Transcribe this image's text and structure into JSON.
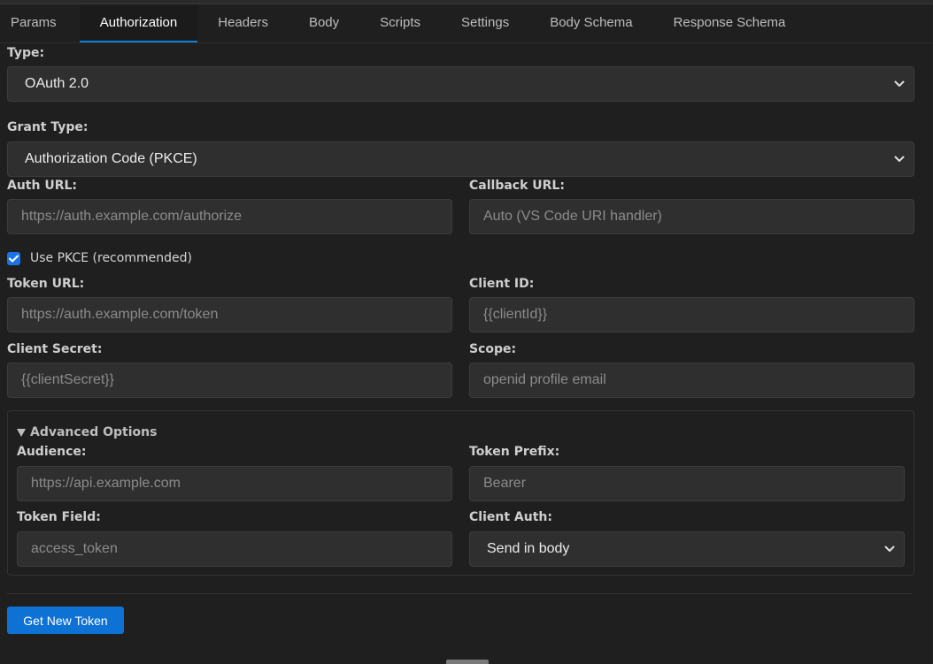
{
  "tabs": [
    {
      "label": "Params"
    },
    {
      "label": "Authorization"
    },
    {
      "label": "Headers"
    },
    {
      "label": "Body"
    },
    {
      "label": "Scripts"
    },
    {
      "label": "Settings"
    },
    {
      "label": "Body Schema"
    },
    {
      "label": "Response Schema"
    }
  ],
  "active_tab": "Authorization",
  "auth": {
    "type_label": "Type:",
    "type_value": "OAuth 2.0",
    "grant_label": "Grant Type:",
    "grant_value": "Authorization Code (PKCE)",
    "auth_url_label": "Auth URL:",
    "auth_url_placeholder": "https://auth.example.com/authorize",
    "callback_label": "Callback URL:",
    "callback_placeholder": "Auto (VS Code URI handler)",
    "pkce_label": "Use PKCE (recommended)",
    "pkce_checked": true,
    "token_url_label": "Token URL:",
    "token_url_placeholder": "https://auth.example.com/token",
    "client_id_label": "Client ID:",
    "client_id_placeholder": "{{clientId}}",
    "client_secret_label": "Client Secret:",
    "client_secret_placeholder": "{{clientSecret}}",
    "scope_label": "Scope:",
    "scope_placeholder": "openid profile email"
  },
  "advanced": {
    "summary": "Advanced Options",
    "audience_label": "Audience:",
    "audience_placeholder": "https://api.example.com",
    "token_prefix_label": "Token Prefix:",
    "token_prefix_placeholder": "Bearer",
    "token_field_label": "Token Field:",
    "token_field_placeholder": "access_token",
    "client_auth_label": "Client Auth:",
    "client_auth_value": "Send in body"
  },
  "actions": {
    "get_token_label": "Get New Token"
  },
  "colors": {
    "accent": "#0e7fd9",
    "button": "#0e72d4",
    "background": "#1f1f1f"
  }
}
